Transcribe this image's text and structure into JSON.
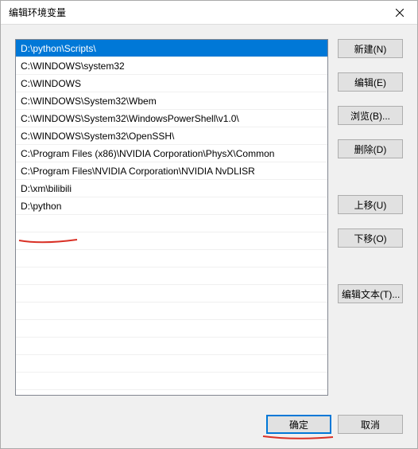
{
  "window": {
    "title": "编辑环境变量"
  },
  "list": {
    "items": [
      "D:\\python\\Scripts\\",
      "C:\\WINDOWS\\system32",
      "C:\\WINDOWS",
      "C:\\WINDOWS\\System32\\Wbem",
      "C:\\WINDOWS\\System32\\WindowsPowerShell\\v1.0\\",
      "C:\\WINDOWS\\System32\\OpenSSH\\",
      "C:\\Program Files (x86)\\NVIDIA Corporation\\PhysX\\Common",
      "C:\\Program Files\\NVIDIA Corporation\\NVIDIA NvDLISR",
      "D:\\xm\\bilibili",
      "D:\\python"
    ],
    "selected_index": 0
  },
  "buttons": {
    "new": "新建(N)",
    "edit": "编辑(E)",
    "browse": "浏览(B)...",
    "delete": "删除(D)",
    "moveup": "上移(U)",
    "movedown": "下移(O)",
    "edittext": "编辑文本(T)...",
    "ok": "确定",
    "cancel": "取消"
  }
}
